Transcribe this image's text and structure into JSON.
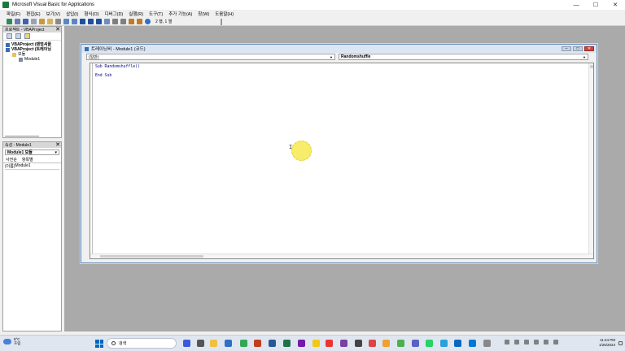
{
  "window": {
    "title": "Microsoft Visual Basic for Applications",
    "minimize": "—",
    "maximize": "☐",
    "close": "✕"
  },
  "menu": [
    "파일(F)",
    "편집(E)",
    "보기(V)",
    "삽입(I)",
    "형식(O)",
    "디버그(D)",
    "실행(R)",
    "도구(T)",
    "추가 기능(A)",
    "창(W)",
    "도움말(H)"
  ],
  "toolbar": {
    "position": "2 행, 1 열"
  },
  "project_pane": {
    "title": "프로젝트 - VBAProject",
    "close": "✕",
    "tree": {
      "project1": "VBAProject (랜덤셔플",
      "project2": "VBAProject (트레이닝",
      "folder": "모듈",
      "module": "Module1"
    }
  },
  "props_pane": {
    "title": "속성 - Module1",
    "close": "✕",
    "object_select": "Module1 모듈",
    "tabs": [
      "사전순",
      "항목별"
    ],
    "row_name": "(이름)",
    "row_value": "Module1"
  },
  "code_window": {
    "title": "트레이닝비 - Module1 (코드)",
    "object_combo": "(일반)",
    "proc_combo": "Randomshuffle",
    "lines": [
      "Sub Randomshuffle()",
      "",
      "End Sub"
    ]
  },
  "taskbar": {
    "temperature": "8°C",
    "weather": "흐림",
    "search_placeholder": "검색",
    "time": "11:24 PM",
    "date": "1/26/2024"
  },
  "colors": {
    "accent": "#0067c0",
    "code_text": "#000080",
    "close_red": "#c9473b",
    "workspace": "#aaaaaa"
  }
}
